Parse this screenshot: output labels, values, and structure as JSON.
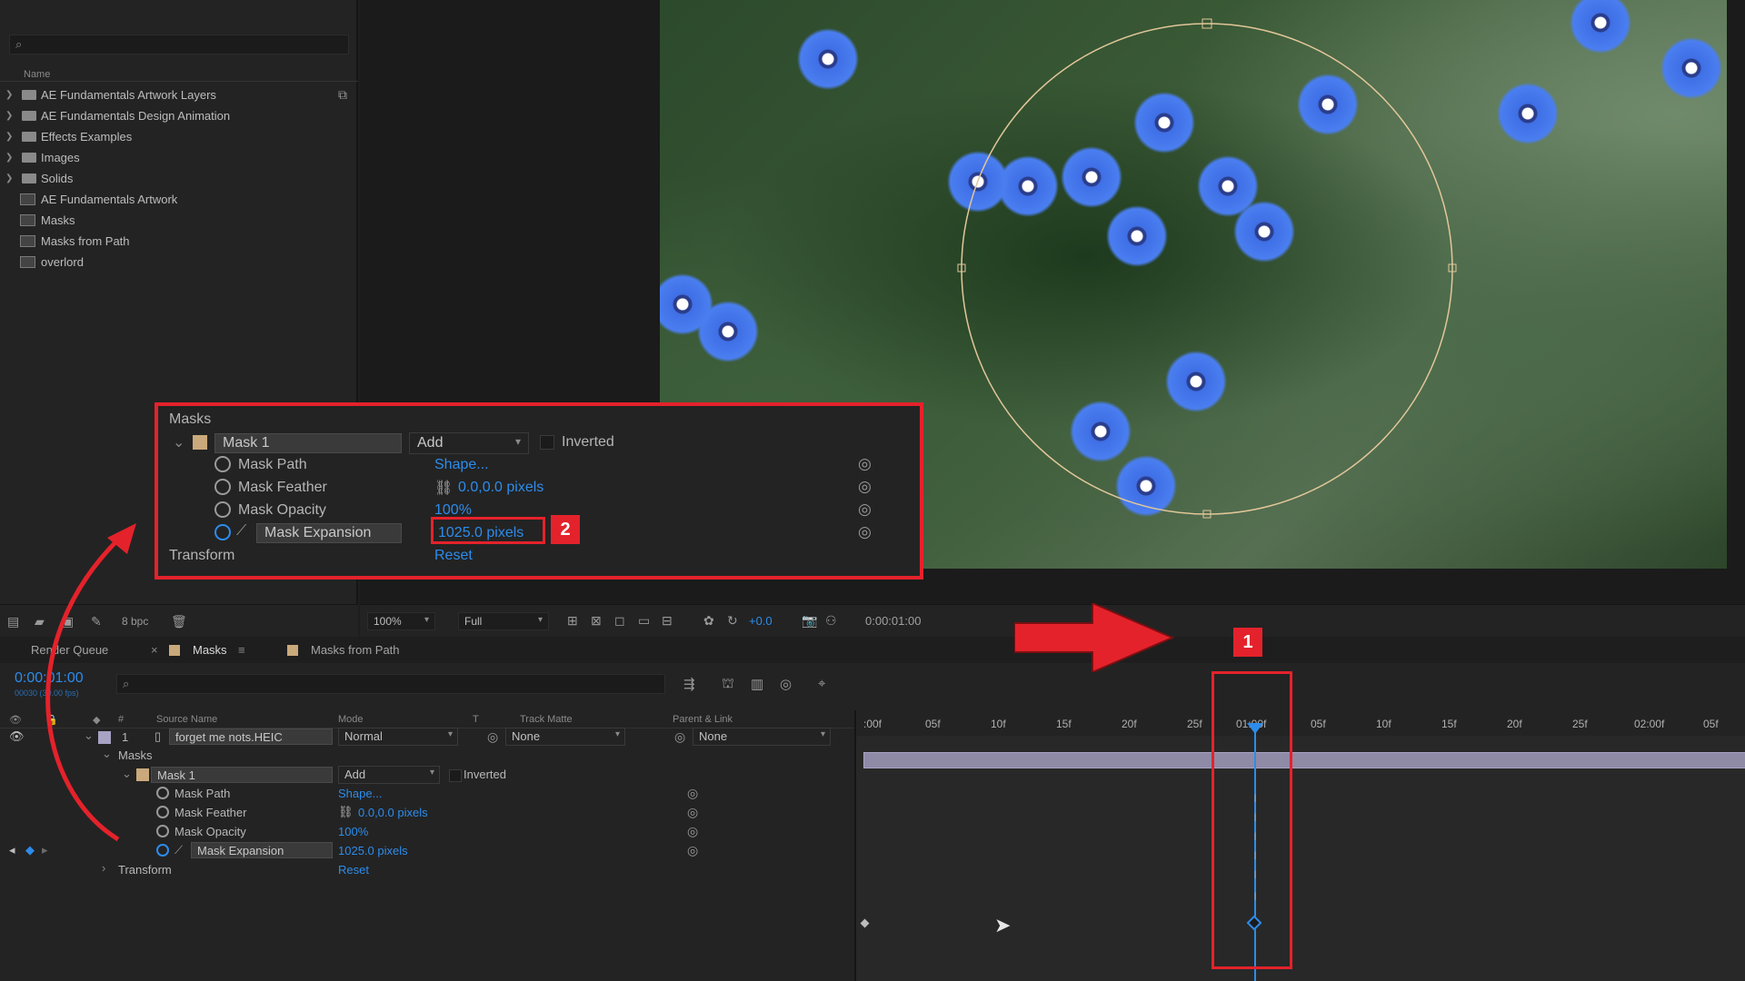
{
  "project": {
    "search_placeholder": "",
    "column_name": "Name",
    "items": [
      {
        "label": "AE Fundamentals Artwork Layers",
        "type": "folder"
      },
      {
        "label": "AE Fundamentals Design Animation",
        "type": "folder"
      },
      {
        "label": "Effects Examples",
        "type": "folder"
      },
      {
        "label": "Images",
        "type": "folder"
      },
      {
        "label": "Solids",
        "type": "folder"
      },
      {
        "label": "AE Fundamentals Artwork",
        "type": "comp"
      },
      {
        "label": "Masks",
        "type": "comp"
      },
      {
        "label": "Masks from Path",
        "type": "comp"
      },
      {
        "label": "overlord",
        "type": "comp"
      }
    ],
    "bpc": "8 bpc"
  },
  "viewer": {
    "zoom": "100%",
    "resolution": "Full",
    "exposure": "+0.0",
    "time": "0:00:01:00"
  },
  "callout": {
    "section": "Masks",
    "mask_name": "Mask 1",
    "mode": "Add",
    "inverted": "Inverted",
    "props": [
      {
        "name": "Mask Path",
        "value": "Shape..."
      },
      {
        "name": "Mask Feather",
        "value": "0.0,0.0 pixels"
      },
      {
        "name": "Mask Opacity",
        "value": "100%"
      },
      {
        "name": "Mask Expansion",
        "value": "1025.0 pixels"
      }
    ],
    "transform": "Transform",
    "transform_value": "Reset",
    "badge2": "2"
  },
  "badge1": "1",
  "timeline": {
    "tabs": [
      "Render Queue",
      "Masks",
      "Masks from Path"
    ],
    "timecode": "0:00:01:00",
    "fps": "00030 (30.00 fps)",
    "columns": {
      "source": "Source Name",
      "mode": "Mode",
      "t": "T",
      "trackmatte": "Track Matte",
      "parent": "Parent & Link"
    },
    "layer": {
      "num": "1",
      "name": "forget me nots.HEIC",
      "mode": "Normal",
      "matte": "None",
      "parent": "None"
    },
    "masks_label": "Masks",
    "mask1": {
      "name": "Mask 1",
      "mode": "Add",
      "inverted": "Inverted"
    },
    "props": [
      {
        "name": "Mask Path",
        "value": "Shape..."
      },
      {
        "name": "Mask Feather",
        "value": "0.0,0.0 pixels"
      },
      {
        "name": "Mask Opacity",
        "value": "100%"
      },
      {
        "name": "Mask Expansion",
        "value": "1025.0 pixels"
      }
    ],
    "transform": "Transform",
    "transform_value": "Reset",
    "ruler": [
      ":00f",
      "05f",
      "10f",
      "15f",
      "20f",
      "25f",
      "01:00f",
      "05f",
      "10f",
      "15f",
      "20f",
      "25f",
      "02:00f",
      "05f"
    ]
  },
  "colors": {
    "accent": "#2d8ceb",
    "highlight": "#e4222b",
    "label": "#caa97b"
  }
}
